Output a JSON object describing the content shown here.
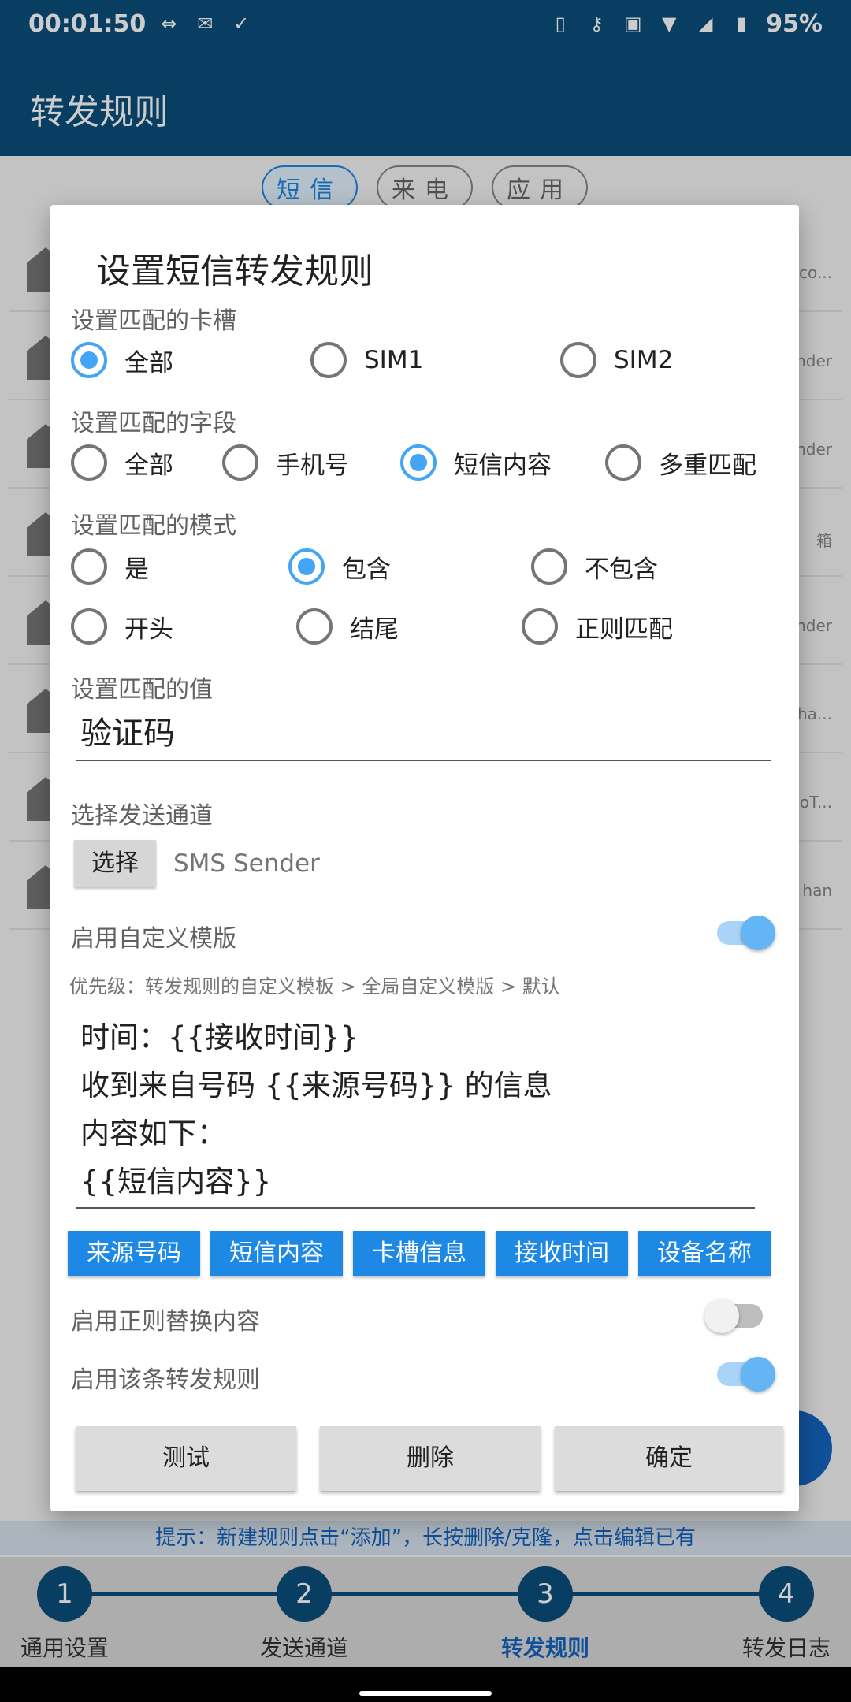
{
  "status_bar": {
    "time": "00:01:50",
    "battery": "95%",
    "icons": [
      "remote-icon",
      "mail-forward-icon",
      "check-icon",
      "phone-icon",
      "key-icon",
      "vibrate-icon",
      "wifi-icon",
      "signal-icon",
      "battery-icon"
    ]
  },
  "app_bar": {
    "title": "转发规则"
  },
  "background": {
    "chips": [
      {
        "label": "短信",
        "active": true
      },
      {
        "label": "来电",
        "active": false
      },
      {
        "label": "应用",
        "active": false
      }
    ],
    "row_tails": [
      "co...",
      "nder",
      "nder",
      "箱",
      "nder",
      "ha...",
      "oT...",
      "han"
    ],
    "hint": "提示：新建规则点击“添加”，长按删除/克隆，点击编辑已有"
  },
  "stepper": [
    {
      "number": "1",
      "label": "通用设置",
      "active": false
    },
    {
      "number": "2",
      "label": "发送通道",
      "active": false
    },
    {
      "number": "3",
      "label": "转发规则",
      "active": true
    },
    {
      "number": "4",
      "label": "转发日志",
      "active": false
    }
  ],
  "dialog": {
    "title": "设置短信转发规则",
    "sim_slot": {
      "label": "设置匹配的卡槽",
      "options": [
        "全部",
        "SIM1",
        "SIM2"
      ],
      "selected": "全部"
    },
    "field": {
      "label": "设置匹配的字段",
      "options": [
        "全部",
        "手机号",
        "短信内容",
        "多重匹配"
      ],
      "selected": "短信内容"
    },
    "mode": {
      "label": "设置匹配的模式",
      "options": [
        "是",
        "包含",
        "不包含",
        "开头",
        "结尾",
        "正则匹配"
      ],
      "selected": "包含"
    },
    "match_value": {
      "label": "设置匹配的值",
      "value": "验证码"
    },
    "channel": {
      "label": "选择发送通道",
      "button": "选择",
      "selected": "SMS Sender"
    },
    "custom_template": {
      "label": "启用自定义模版",
      "enabled": true,
      "priority": "优先级：转发规则的自定义模板 > 全局自定义模版 > 默认",
      "lines": [
        "时间：{{接收时间}}",
        "收到来自号码 {{来源号码}} 的信息",
        "内容如下：",
        "{{短信内容}}"
      ],
      "tags": [
        "来源号码",
        "短信内容",
        "卡槽信息",
        "接收时间",
        "设备名称"
      ]
    },
    "regex_replace": {
      "label": "启用正则替换内容",
      "enabled": false
    },
    "rule_enabled": {
      "label": "启用该条转发规则",
      "enabled": true
    },
    "buttons": {
      "test": "测试",
      "delete": "删除",
      "confirm": "确定"
    }
  },
  "colors": {
    "primary": "#0b4e7a",
    "accent": "#42a5f5",
    "tag": "#1e88e5"
  }
}
